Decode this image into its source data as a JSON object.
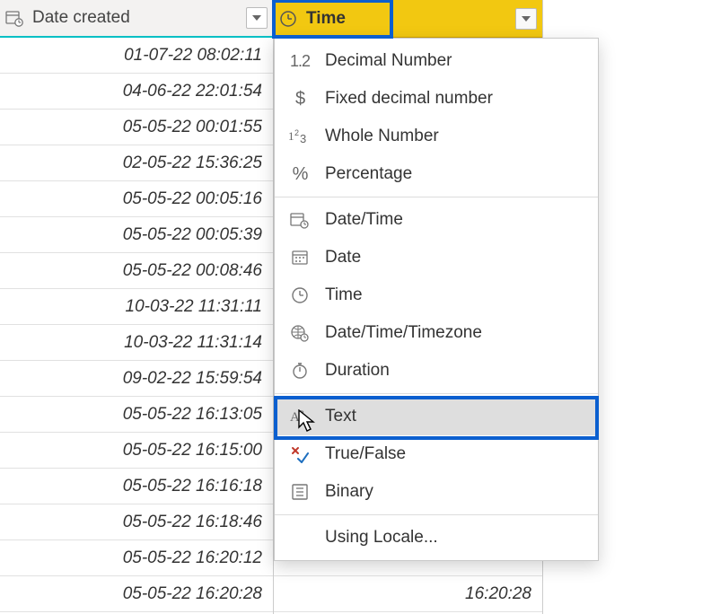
{
  "columns": {
    "date": {
      "label": "Date created",
      "values": [
        "01-07-22 08:02:11",
        "04-06-22 22:01:54",
        "05-05-22 00:01:55",
        "02-05-22 15:36:25",
        "05-05-22 00:05:16",
        "05-05-22 00:05:39",
        "05-05-22 00:08:46",
        "10-03-22 11:31:11",
        "10-03-22 11:31:14",
        "09-02-22 15:59:54",
        "05-05-22 16:13:05",
        "05-05-22 16:15:00",
        "05-05-22 16:16:18",
        "05-05-22 16:18:46",
        "05-05-22 16:20:12",
        "05-05-22 16:20:28"
      ]
    },
    "time": {
      "label": "Time",
      "values": {
        "15": "16:20:28"
      }
    }
  },
  "menu": {
    "group1": [
      {
        "key": "decimal",
        "label": "Decimal Number",
        "icon": "1.2"
      },
      {
        "key": "fixed",
        "label": "Fixed decimal number",
        "icon": "$"
      },
      {
        "key": "whole",
        "label": "Whole Number",
        "icon": "123"
      },
      {
        "key": "percent",
        "label": "Percentage",
        "icon": "%"
      }
    ],
    "group2": [
      {
        "key": "datetime",
        "label": "Date/Time",
        "icon": "datetime"
      },
      {
        "key": "date",
        "label": "Date",
        "icon": "date"
      },
      {
        "key": "time",
        "label": "Time",
        "icon": "time"
      },
      {
        "key": "dttz",
        "label": "Date/Time/Timezone",
        "icon": "dttz"
      },
      {
        "key": "duration",
        "label": "Duration",
        "icon": "duration"
      }
    ],
    "group3": [
      {
        "key": "text",
        "label": "Text",
        "icon": "abc",
        "selected": true
      },
      {
        "key": "boolean",
        "label": "True/False",
        "icon": "truefalse"
      },
      {
        "key": "binary",
        "label": "Binary",
        "icon": "binary"
      }
    ],
    "group4": [
      {
        "key": "locale",
        "label": "Using Locale...",
        "icon": ""
      }
    ]
  }
}
